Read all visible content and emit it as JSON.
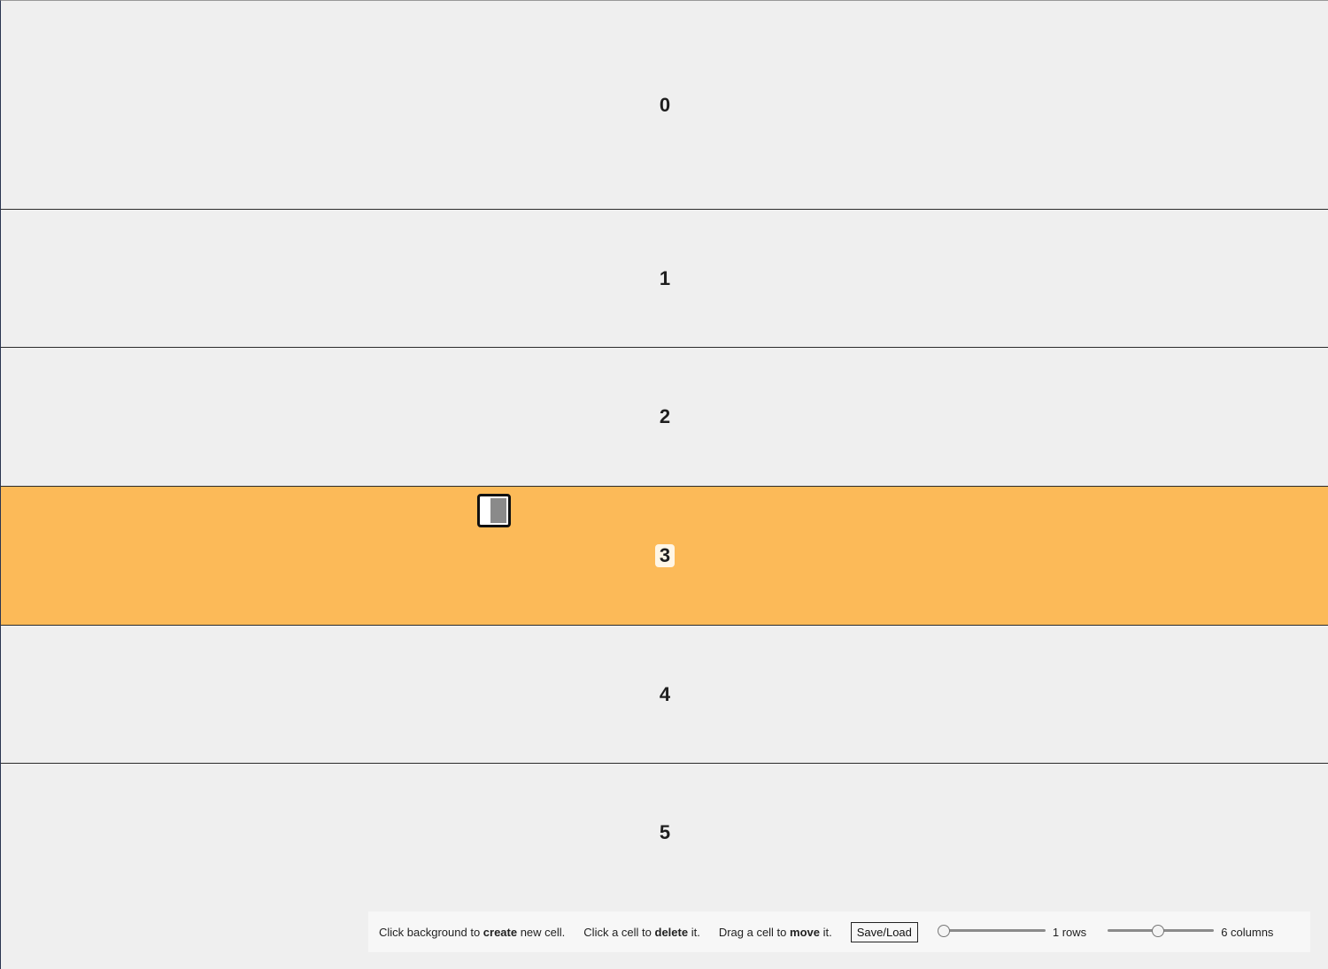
{
  "cells": [
    {
      "label": "0",
      "highlighted": false
    },
    {
      "label": "1",
      "highlighted": false
    },
    {
      "label": "2",
      "highlighted": false
    },
    {
      "label": "3",
      "highlighted": true
    },
    {
      "label": "4",
      "highlighted": false
    },
    {
      "label": "5",
      "highlighted": false
    }
  ],
  "colors": {
    "background": "#efefef",
    "highlight": "#fcba58",
    "border": "#2b2b2b"
  },
  "toolbar": {
    "hint_create_pre": "Click background to ",
    "hint_create_bold": "create",
    "hint_create_post": " new cell.",
    "hint_delete_pre": "Click a cell to ",
    "hint_delete_bold": "delete",
    "hint_delete_post": " it.",
    "hint_move_pre": "Drag a cell to ",
    "hint_move_bold": "move",
    "hint_move_post": " it.",
    "save_load_label": "Save/Load",
    "rows_label": "1 rows",
    "rows_fraction": 0.0,
    "columns_label": "6 columns",
    "columns_fraction": 0.47
  },
  "cursor_icon": "drag-handle-icon"
}
